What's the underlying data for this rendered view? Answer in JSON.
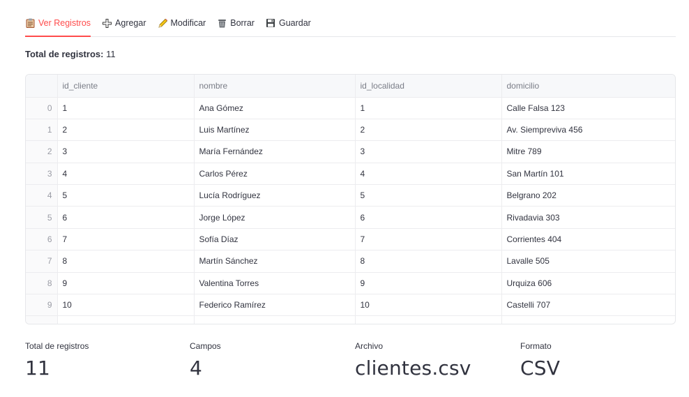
{
  "tabs": [
    {
      "label": "Ver Registros",
      "icon": "clipboard-icon",
      "active": true
    },
    {
      "label": "Agregar",
      "icon": "plus-icon",
      "active": false
    },
    {
      "label": "Modificar",
      "icon": "pencil-icon",
      "active": false
    },
    {
      "label": "Borrar",
      "icon": "trash-icon",
      "active": false
    },
    {
      "label": "Guardar",
      "icon": "floppy-disk-icon",
      "active": false
    }
  ],
  "total": {
    "label": "Total de registros:",
    "value": "11"
  },
  "table": {
    "columns": [
      "id_cliente",
      "nombre",
      "id_localidad",
      "domicilio"
    ],
    "rows": [
      {
        "idx": "0",
        "id_cliente": "1",
        "nombre": "Ana Gómez",
        "id_localidad": "1",
        "domicilio": "Calle Falsa 123"
      },
      {
        "idx": "1",
        "id_cliente": "2",
        "nombre": "Luis Martínez",
        "id_localidad": "2",
        "domicilio": "Av. Siempreviva 456"
      },
      {
        "idx": "2",
        "id_cliente": "3",
        "nombre": "María Fernández",
        "id_localidad": "3",
        "domicilio": "Mitre 789"
      },
      {
        "idx": "3",
        "id_cliente": "4",
        "nombre": "Carlos Pérez",
        "id_localidad": "4",
        "domicilio": "San Martín 101"
      },
      {
        "idx": "4",
        "id_cliente": "5",
        "nombre": "Lucía Rodríguez",
        "id_localidad": "5",
        "domicilio": "Belgrano 202"
      },
      {
        "idx": "5",
        "id_cliente": "6",
        "nombre": "Jorge López",
        "id_localidad": "6",
        "domicilio": "Rivadavia 303"
      },
      {
        "idx": "6",
        "id_cliente": "7",
        "nombre": "Sofía Díaz",
        "id_localidad": "7",
        "domicilio": "Corrientes 404"
      },
      {
        "idx": "7",
        "id_cliente": "8",
        "nombre": "Martín Sánchez",
        "id_localidad": "8",
        "domicilio": "Lavalle 505"
      },
      {
        "idx": "8",
        "id_cliente": "9",
        "nombre": "Valentina Torres",
        "id_localidad": "9",
        "domicilio": "Urquiza 606"
      },
      {
        "idx": "9",
        "id_cliente": "10",
        "nombre": "Federico Ramírez",
        "id_localidad": "10",
        "domicilio": "Castelli 707"
      }
    ]
  },
  "metrics": [
    {
      "label": "Total de registros",
      "value": "11"
    },
    {
      "label": "Campos",
      "value": "4"
    },
    {
      "label": "Archivo",
      "value": "clientes.csv"
    },
    {
      "label": "Formato",
      "value": "CSV"
    }
  ],
  "colors": {
    "accent": "#ff4b4b",
    "text": "#31333f",
    "border": "#e6e7ea"
  }
}
